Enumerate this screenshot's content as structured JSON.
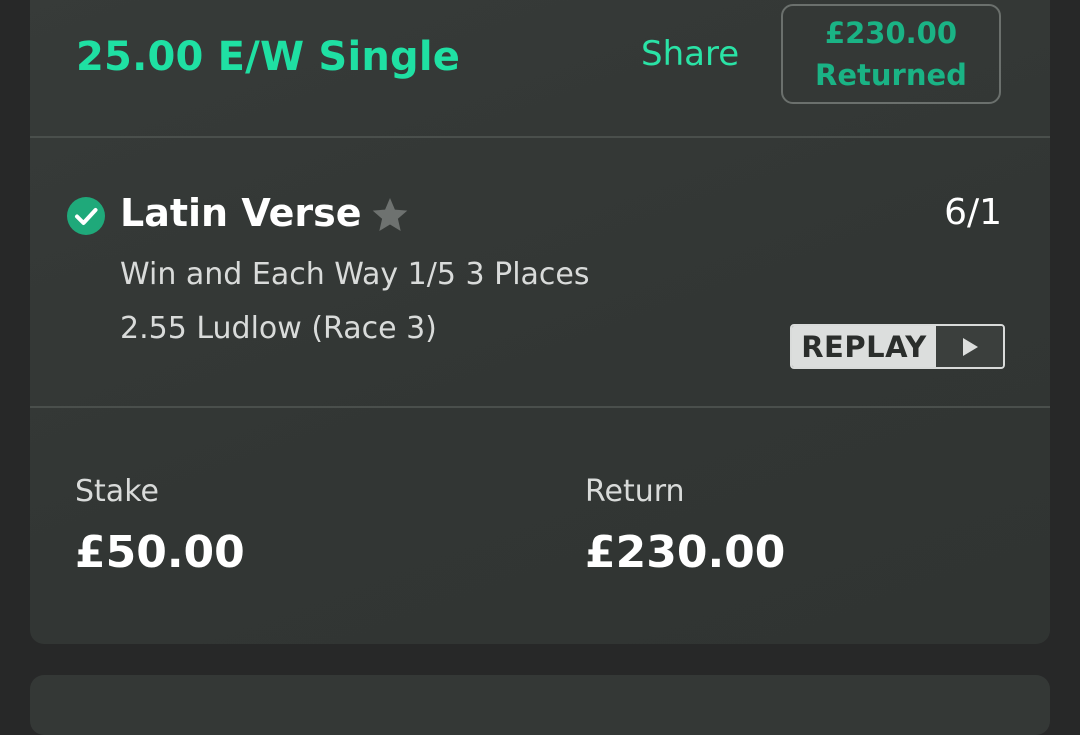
{
  "bet": {
    "title": "25.00 E/W Single",
    "share_label": "Share",
    "returned_amount": "£230.00",
    "returned_label": "Returned"
  },
  "selection": {
    "name": "Latin Verse",
    "odds": "6/1",
    "market": "Win and Each Way 1/5 3 Places",
    "event": "2.55 Ludlow (Race 3)",
    "status": "won",
    "replay_label": "REPLAY"
  },
  "totals": {
    "stake_label": "Stake",
    "stake_value": "£50.00",
    "return_label": "Return",
    "return_value": "£230.00"
  },
  "colors": {
    "accent": "#1fe0a3",
    "returned": "#1ab385",
    "check": "#1fa97a",
    "card_bg": "#353937",
    "page_bg": "#272828"
  },
  "icons": {
    "status": "check-circle-icon",
    "favourite": "star-icon",
    "replay": "play-icon"
  }
}
